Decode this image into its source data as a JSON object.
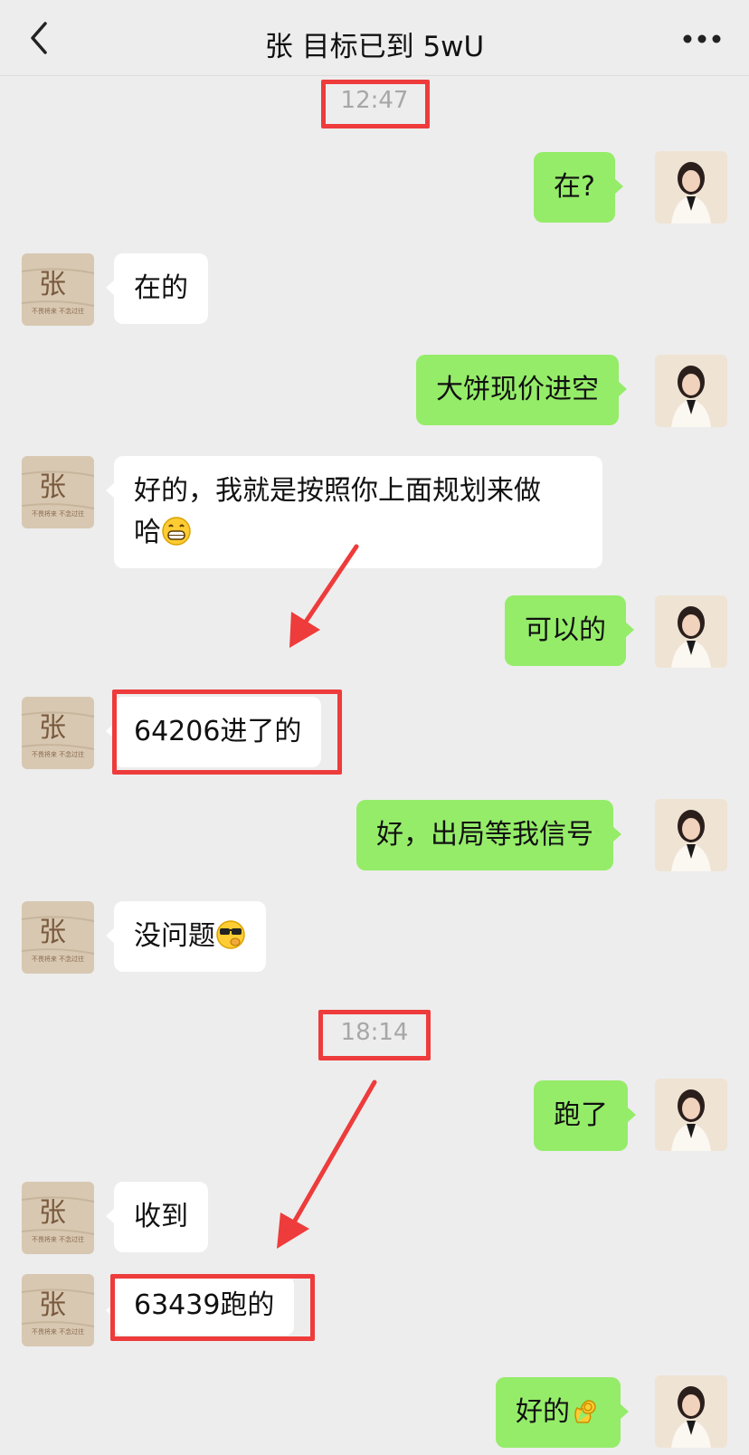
{
  "header": {
    "title": "张 目标已到 5wU"
  },
  "timestamps": [
    "12:47",
    "18:14"
  ],
  "messages": [
    {
      "side": "out",
      "text": "在?"
    },
    {
      "side": "in",
      "text": "在的"
    },
    {
      "side": "out",
      "text": "大饼现价进空"
    },
    {
      "side": "in",
      "line1": "好的，我就是按照你上面规划来做",
      "line2": "哈",
      "emoji": "grinning-face"
    },
    {
      "side": "out",
      "text": "可以的"
    },
    {
      "side": "in",
      "text": "64206进了的"
    },
    {
      "side": "out",
      "text": "好，出局等我信号"
    },
    {
      "side": "in",
      "text": "没问题",
      "emoji": "shushing-sunglasses-face"
    },
    {
      "side": "out",
      "text": "跑了"
    },
    {
      "side": "in",
      "text": "收到"
    },
    {
      "side": "in",
      "text": "63439跑的"
    },
    {
      "side": "out",
      "text": "好的",
      "emoji": "ok-hand"
    }
  ],
  "avatars": {
    "contact": {
      "glyph": "张",
      "tagline": "不畏将来 不念过往"
    }
  },
  "colors": {
    "background": "#ededed",
    "incoming_bubble": "#ffffff",
    "outgoing_bubble": "#95ec69",
    "highlight_box": "#ee3b3b",
    "arrow": "#ee3b3b"
  }
}
